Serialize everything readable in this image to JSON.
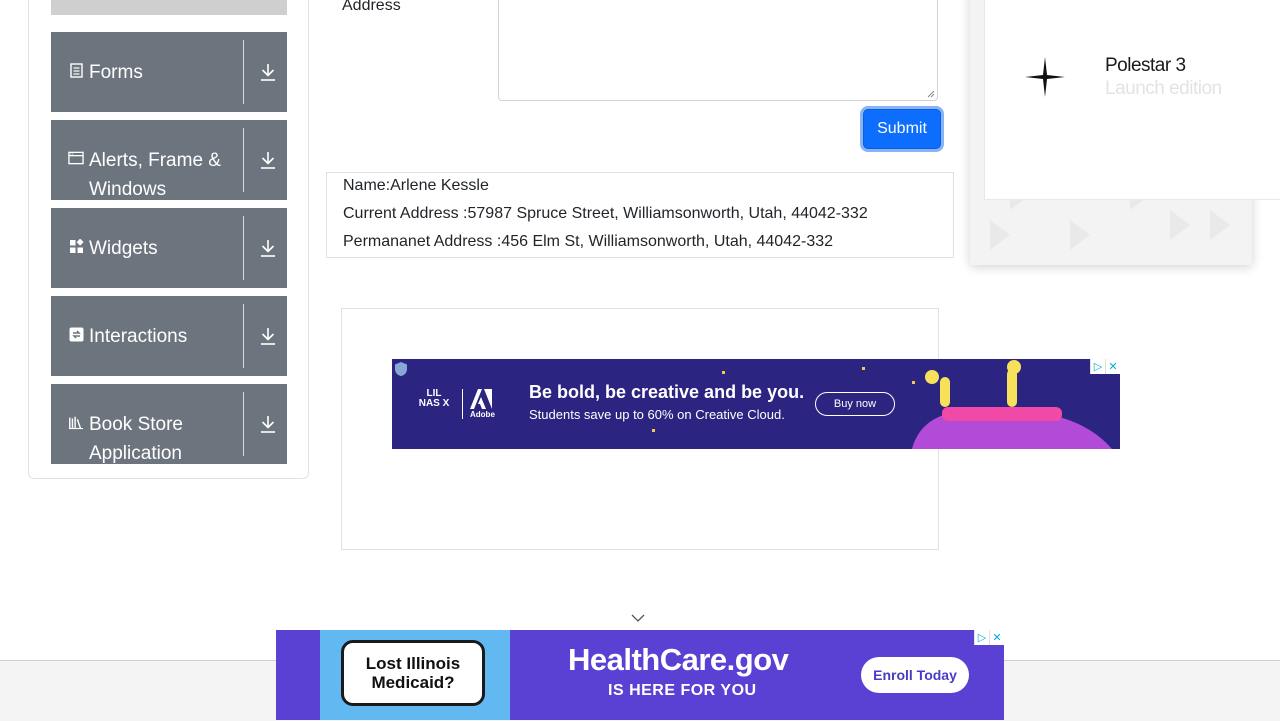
{
  "sidebar": {
    "groups": [
      {
        "label": "Forms",
        "icon": "forms-icon"
      },
      {
        "label": "Alerts, Frame & Windows",
        "icon": "window-icon"
      },
      {
        "label": "Widgets",
        "icon": "widgets-icon"
      },
      {
        "label": "Interactions",
        "icon": "interactions-icon"
      },
      {
        "label": "Book Store Application",
        "icon": "book-icon"
      }
    ]
  },
  "form": {
    "address_label": "Address",
    "submit_label": "Submit"
  },
  "output": {
    "name_line": "Name:Arlene Kessle",
    "current_address_line": "Current Address :57987 Spruce Street, Williamsonworth, Utah, 44042-332",
    "permanent_address_line": "Permananet Address :456 Elm St, Williamsonworth, Utah, 44042-332"
  },
  "promo": {
    "title": "Polestar 3",
    "subtitle": "Launch edition"
  },
  "ads": {
    "adobe": {
      "headline": "Be bold, be creative and be you.",
      "subline": "Students save up to 60% on Creative Cloud.",
      "button": "Buy now",
      "logo_left": "LIL NAS X",
      "logo_right": "Adobe"
    },
    "healthcare": {
      "bubble": "Lost Illinois Medicaid?",
      "brand": "HealthCare.gov",
      "tagline": "IS HERE FOR YOU",
      "button": "Enroll Today"
    }
  },
  "colors": {
    "sidebar_group_bg": "#6c757d",
    "submit_bg": "#0d6efd",
    "adobe_bg": "#2b2480",
    "healthcare_bg": "#5b40d4"
  }
}
